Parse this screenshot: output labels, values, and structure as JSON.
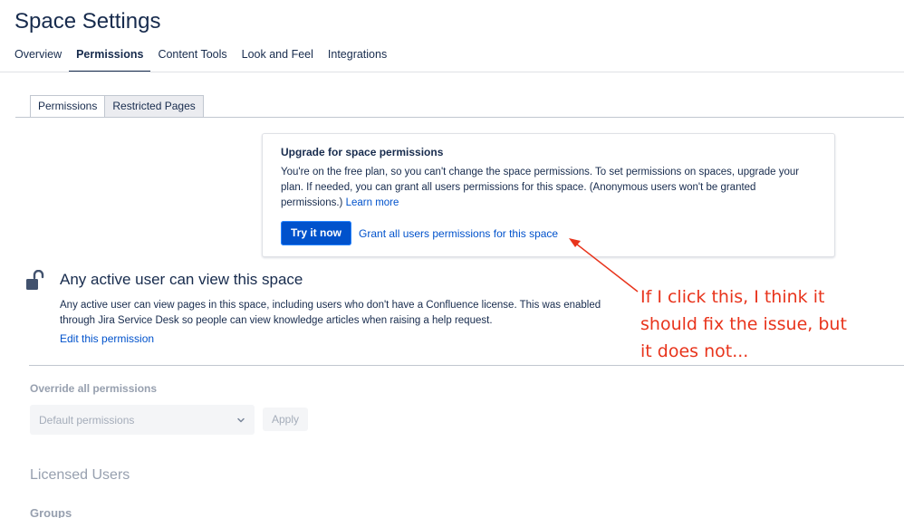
{
  "header": {
    "title": "Space Settings",
    "tabs": [
      {
        "label": "Overview"
      },
      {
        "label": "Permissions"
      },
      {
        "label": "Content Tools"
      },
      {
        "label": "Look and Feel"
      },
      {
        "label": "Integrations"
      }
    ],
    "active_tab": "Permissions"
  },
  "subtabs": [
    {
      "label": "Permissions"
    },
    {
      "label": "Restricted Pages"
    }
  ],
  "upgrade": {
    "title": "Upgrade for space permissions",
    "body": "You're on the free plan, so you can't change the space permissions. To set permissions on spaces, upgrade your plan. If needed, you can grant all users permissions for this space. (Anonymous users won't be granted permissions.)",
    "learn_more": "Learn more",
    "try_button": "Try it now",
    "grant_link": "Grant all users permissions for this space"
  },
  "active_users": {
    "icon": "unlock-icon",
    "title": "Any active user can view this space",
    "description": "Any active user can view pages in this space, including users who don't have a Confluence license. This was enabled through Jira Service Desk so people can view knowledge articles when raising a help request.",
    "edit_link": "Edit this permission"
  },
  "override": {
    "label": "Override all permissions",
    "select_value": "Default permissions",
    "apply_label": "Apply"
  },
  "licensed": {
    "title": "Licensed Users",
    "groups_label": "Groups"
  },
  "annotation": {
    "text": "If I click this, I think it\nshould fix the issue, but\nit does not...",
    "color": "#e8341c"
  },
  "colors": {
    "primary": "#0052cc",
    "text": "#172b4d",
    "muted": "#97a0af"
  }
}
